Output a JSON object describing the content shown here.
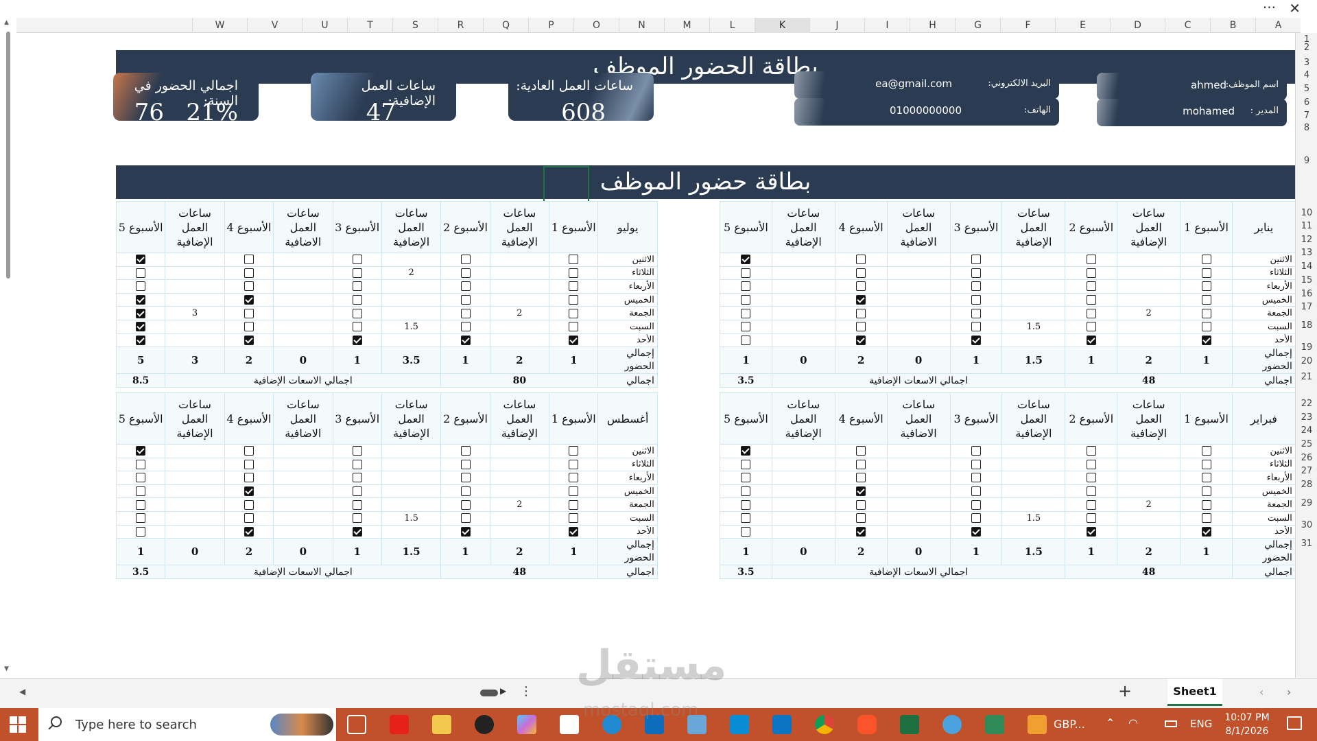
{
  "window": {
    "more_label": "···",
    "close_label": "✕"
  },
  "columns": [
    "A",
    "B",
    "C",
    "D",
    "E",
    "F",
    "G",
    "H",
    "I",
    "J",
    "K",
    "L",
    "M",
    "N",
    "O",
    "P",
    "Q",
    "R",
    "S",
    "T",
    "U",
    "V",
    "W"
  ],
  "selected_column": "K",
  "rows": [
    "1",
    "2",
    "3",
    "4",
    "5",
    "6",
    "7",
    "8",
    "9",
    "10",
    "11",
    "12",
    "13",
    "14",
    "15",
    "16",
    "17",
    "18",
    "19",
    "20",
    "21",
    "22",
    "23",
    "24",
    "25",
    "26",
    "27",
    "28",
    "29",
    "30",
    "31"
  ],
  "title_banner": "بطاقة الحضور الموظف",
  "section_banner": "بطاقة حضور الموظف",
  "info": {
    "name_label": "اسم الموظف:",
    "name_value": "ahmed",
    "manager_label": "المدير :",
    "manager_value": "mohamed",
    "email_label": "البريد الالكتروني:",
    "email_value": "ea@gmail.com",
    "phone_label": "الهاتف:",
    "phone_value": "01000000000"
  },
  "cards": {
    "regular_label": "ساعات العمل العادية:",
    "regular_value": "608",
    "overtime_label": "ساعات العمل الإضافية:",
    "overtime_value": "47",
    "annual_label": "اجمالي الحضور في السنة:",
    "annual_days": "76",
    "annual_pct": "21%"
  },
  "labels": {
    "week1": "الأسبوع 1",
    "week2": "الأسبوع 2",
    "week3": "الأسبوع 3",
    "week4": "الأسبوع 4",
    "week5": "الأسبوع 5",
    "overtime_a": "ساعات العمل الإضافية",
    "overtime_b": "ساعات العمل الاضافية",
    "total_attendance": "إجمالي الحضور",
    "grand_total": "اجمالي",
    "total_overtime": "اجمالي الاسعات الإضافية"
  },
  "days": [
    "الاثنين",
    "الثلاثاء",
    "الأربعاء",
    "الخميس",
    "الجمعة",
    "السبت",
    "الأحد"
  ],
  "months": [
    {
      "name": "يناير",
      "checks": [
        [
          0,
          0,
          0,
          0,
          1
        ],
        [
          0,
          0,
          0,
          0,
          0
        ],
        [
          0,
          0,
          0,
          0,
          0
        ],
        [
          0,
          0,
          0,
          1,
          0
        ],
        [
          0,
          0,
          0,
          0,
          0
        ],
        [
          0,
          0,
          0,
          0,
          0
        ],
        [
          1,
          1,
          1,
          1,
          0
        ]
      ],
      "overtime": [
        [
          "",
          "",
          "",
          ""
        ],
        [
          "",
          "",
          "",
          ""
        ],
        [
          "",
          "",
          "",
          ""
        ],
        [
          "",
          "",
          "",
          ""
        ],
        [
          "2",
          "",
          "",
          ""
        ],
        [
          "",
          "1.5",
          "",
          ""
        ],
        [
          "",
          "",
          "",
          ""
        ]
      ],
      "totals": [
        "1",
        "2",
        "1",
        "1.5",
        "1",
        "0",
        "2",
        "0",
        "1"
      ],
      "grand_total": "48",
      "overtime_total": "3.5"
    },
    {
      "name": "يوليو",
      "checks": [
        [
          0,
          0,
          0,
          0,
          1
        ],
        [
          0,
          0,
          0,
          0,
          0
        ],
        [
          0,
          0,
          0,
          0,
          0
        ],
        [
          0,
          0,
          0,
          1,
          1
        ],
        [
          0,
          0,
          0,
          0,
          1
        ],
        [
          0,
          0,
          0,
          0,
          1
        ],
        [
          1,
          1,
          1,
          1,
          1
        ]
      ],
      "overtime": [
        [
          "",
          "",
          "",
          ""
        ],
        [
          "",
          "2",
          "",
          ""
        ],
        [
          "",
          "",
          "",
          ""
        ],
        [
          "",
          "",
          "",
          ""
        ],
        [
          "2",
          "",
          "",
          "3"
        ],
        [
          "",
          "1.5",
          "",
          ""
        ],
        [
          "",
          "",
          "",
          ""
        ]
      ],
      "totals": [
        "1",
        "2",
        "1",
        "3.5",
        "1",
        "0",
        "2",
        "3",
        "5"
      ],
      "grand_total": "80",
      "overtime_total": "8.5"
    },
    {
      "name": "فبراير",
      "checks": [
        [
          0,
          0,
          0,
          0,
          1
        ],
        [
          0,
          0,
          0,
          0,
          0
        ],
        [
          0,
          0,
          0,
          0,
          0
        ],
        [
          0,
          0,
          0,
          1,
          0
        ],
        [
          0,
          0,
          0,
          0,
          0
        ],
        [
          0,
          0,
          0,
          0,
          0
        ],
        [
          1,
          1,
          1,
          1,
          0
        ]
      ],
      "overtime": [
        [
          "",
          "",
          "",
          ""
        ],
        [
          "",
          "",
          "",
          ""
        ],
        [
          "",
          "",
          "",
          ""
        ],
        [
          "",
          "",
          "",
          ""
        ],
        [
          "2",
          "",
          "",
          ""
        ],
        [
          "",
          "1.5",
          "",
          ""
        ],
        [
          "",
          "",
          "",
          ""
        ]
      ],
      "totals": [
        "1",
        "2",
        "1",
        "1.5",
        "1",
        "0",
        "2",
        "0",
        "1"
      ],
      "grand_total": "48",
      "overtime_total": "3.5"
    },
    {
      "name": "أغسطس",
      "checks": [
        [
          0,
          0,
          0,
          0,
          1
        ],
        [
          0,
          0,
          0,
          0,
          0
        ],
        [
          0,
          0,
          0,
          0,
          0
        ],
        [
          0,
          0,
          0,
          1,
          0
        ],
        [
          0,
          0,
          0,
          0,
          0
        ],
        [
          0,
          0,
          0,
          0,
          0
        ],
        [
          1,
          1,
          1,
          1,
          0
        ]
      ],
      "overtime": [
        [
          "",
          "",
          "",
          ""
        ],
        [
          "",
          "",
          "",
          ""
        ],
        [
          "",
          "",
          "",
          ""
        ],
        [
          "",
          "",
          "",
          ""
        ],
        [
          "2",
          "",
          "",
          ""
        ],
        [
          "",
          "1.5",
          "",
          ""
        ],
        [
          "",
          "",
          "",
          ""
        ]
      ],
      "totals": [
        "1",
        "2",
        "1",
        "1.5",
        "1",
        "0",
        "2",
        "0",
        "1"
      ],
      "grand_total": "48",
      "overtime_total": "3.5"
    }
  ],
  "sheet_tabs": {
    "active": "Sheet1",
    "add_label": "+"
  },
  "taskbar": {
    "search_placeholder": "Type here to search",
    "tray_text": "GBP...",
    "lang": "ENG",
    "time": "10:07 PM",
    "date": "8/1/2026"
  },
  "watermark": {
    "text": "مستقل",
    "sub": "mostaql.com"
  }
}
